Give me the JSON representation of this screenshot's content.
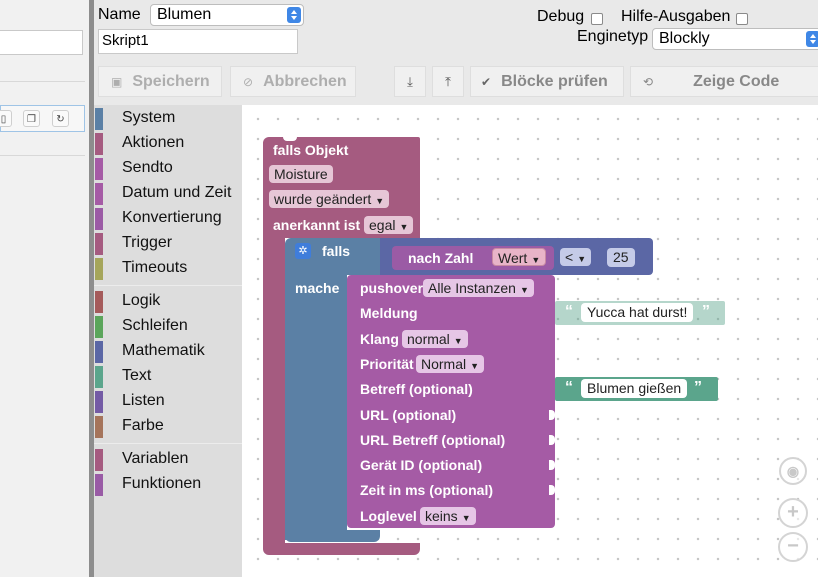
{
  "header": {
    "name_label": "Name",
    "name_value": "Blumen",
    "script_name": "Skript1",
    "debug_label": "Debug",
    "debug_checked": false,
    "help_label": "Hilfe-Ausgaben",
    "help_checked": false,
    "engine_label": "Enginetyp",
    "engine_value": "Blockly"
  },
  "toolbar": {
    "save_label": "Speichern",
    "cancel_label": "Abbrechen",
    "check_label": "Blöcke prüfen",
    "code_label": "Zeige Code"
  },
  "toolbox": {
    "groups": [
      [
        {
          "label": "System",
          "color": "#5b80a5"
        },
        {
          "label": "Aktionen",
          "color": "#a55b80"
        },
        {
          "label": "Sendto",
          "color": "#a55ba5"
        },
        {
          "label": "Datum und Zeit",
          "color": "#a55ba5"
        },
        {
          "label": "Konvertierung",
          "color": "#9b5ba5"
        },
        {
          "label": "Trigger",
          "color": "#a55b80"
        },
        {
          "label": "Timeouts",
          "color": "#a5a55b"
        }
      ],
      [
        {
          "label": "Logik",
          "color": "#a55b5b"
        },
        {
          "label": "Schleifen",
          "color": "#5ba55b"
        },
        {
          "label": "Mathematik",
          "color": "#5b67a5"
        },
        {
          "label": "Text",
          "color": "#5ba58c"
        },
        {
          "label": "Listen",
          "color": "#745ba5"
        },
        {
          "label": "Farbe",
          "color": "#a5745b"
        }
      ],
      [
        {
          "label": "Variablen",
          "color": "#a55b80"
        },
        {
          "label": "Funktionen",
          "color": "#995ba5"
        }
      ]
    ]
  },
  "blocks": {
    "trigger": {
      "title": "falls Objekt",
      "object": "Moisture",
      "change": "wurde geändert",
      "ack_label": "anerkannt ist",
      "ack_value": "egal",
      "color": "#a55b80"
    },
    "if_block": {
      "if_label": "falls",
      "do_label": "mache",
      "color": "#5b80a5"
    },
    "condition": {
      "tonumber_label": "nach Zahl",
      "value_field": "Wert",
      "operator": "<",
      "number": "25",
      "compare_color": "#5b67a5",
      "tonumber_color": "#9b5ba5"
    },
    "pushover": {
      "title": "pushover",
      "instance": "Alle Instanzen",
      "message_label": "Meldung",
      "sound_label": "Klang",
      "sound_value": "normal",
      "priority_label": "Priorität",
      "priority_value": "Normal",
      "subject_label": "Betreff (optional)",
      "url_label": "URL (optional)",
      "url_title_label": "URL Betreff (optional)",
      "device_label": "Gerät ID (optional)",
      "time_label": "Zeit in ms (optional)",
      "loglevel_label": "Loglevel",
      "loglevel_value": "keins",
      "color": "#a55ba5"
    },
    "text_message": {
      "value": "Yucca hat durst!",
      "color": "#5ba58c"
    },
    "text_subject": {
      "value": "Blumen gießen",
      "color": "#5ba58c"
    }
  }
}
